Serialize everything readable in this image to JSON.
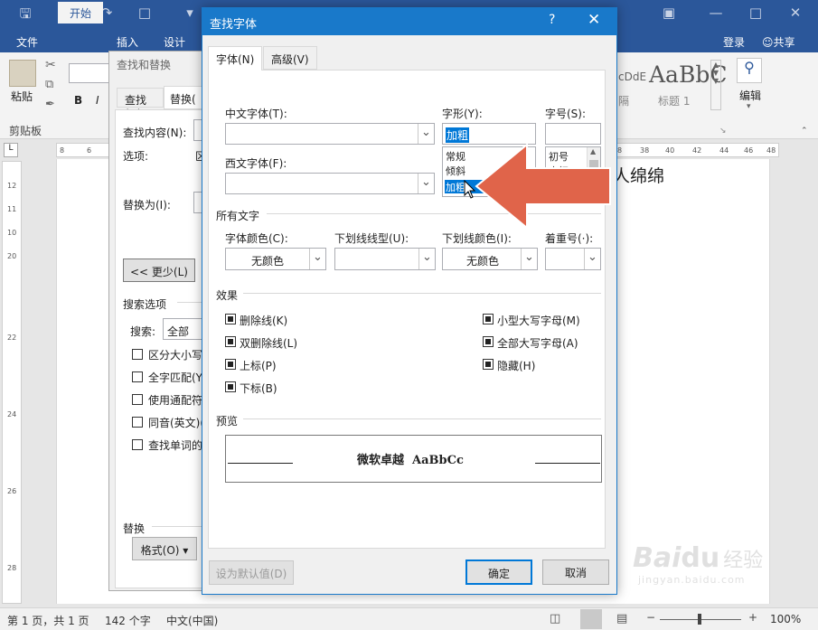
{
  "word": {
    "ribbon_tabs": [
      "文件",
      "开始",
      "插入",
      "设计"
    ],
    "login": "登录",
    "share": "共享",
    "paste_label": "粘贴",
    "clipboard_label": "剪贴板",
    "style_preview": "AaBbC",
    "style_preview2": "cDdE",
    "style_name": "标题 1",
    "style_name_partial": "隔",
    "edit_label": "编辑",
    "doc_text_fragment": "人绵绵",
    "ruler_top": [
      "8",
      "6",
      "4",
      "2",
      "2",
      "4",
      "6",
      "8",
      "38",
      "40",
      "42",
      "44",
      "46",
      "48"
    ],
    "ruler_left": [
      "12",
      "11",
      "10",
      "9",
      "8",
      "7",
      "6",
      "5",
      "4",
      "3",
      "2",
      "1",
      "20",
      "22",
      "24",
      "26",
      "28",
      "30",
      "32",
      "34"
    ],
    "status": {
      "page": "第 1 页，共 1 页",
      "words": "142 个字",
      "language": "中文(中国)",
      "zoom": "100%"
    }
  },
  "find_replace": {
    "title": "查找和替换",
    "tab_find": "查找(D)",
    "tab_replace": "替换(",
    "find_what_label": "查找内容(N):",
    "options_label": "选项:",
    "options_value": "区",
    "replace_with_label": "替换为(I):",
    "less_button": "<< 更少(L)",
    "search_options_label": "搜索选项",
    "search_label": "搜索:",
    "search_value": "全部",
    "checkboxes": [
      "区分大小写",
      "全字匹配(Y)",
      "使用通配符",
      "同音(英文)(",
      "查找单词的所"
    ],
    "replace_section": "替换",
    "format_button": "格式(O)"
  },
  "find_font": {
    "title": "查找字体",
    "help": "?",
    "close": "✕",
    "tab_font": "字体(N)",
    "tab_advanced": "高级(V)",
    "chinese_font_label": "中文字体(T):",
    "western_font_label": "西文字体(F):",
    "style_label": "字形(Y):",
    "size_label": "字号(S):",
    "style_value": "加粗",
    "style_options": [
      "常规",
      "倾斜",
      "加粗"
    ],
    "size_options": [
      "初号",
      "小初"
    ],
    "all_text_label": "所有文字",
    "font_color_label": "字体颜色(C):",
    "font_color_value": "无颜色",
    "underline_style_label": "下划线线型(U):",
    "underline_color_label": "下划线颜色(I):",
    "underline_color_value": "无颜色",
    "emphasis_label": "着重号(·):",
    "effects_label": "效果",
    "effects_left": [
      "删除线(K)",
      "双删除线(L)",
      "上标(P)",
      "下标(B)"
    ],
    "effects_right": [
      "小型大写字母(M)",
      "全部大写字母(A)",
      "隐藏(H)"
    ],
    "preview_label": "预览",
    "preview_text": "微软卓越  AaBbCc",
    "set_default_button": "设为默认值(D)",
    "ok_button": "确定",
    "cancel_button": "取消"
  },
  "watermark": {
    "brand": "Bai",
    "brand2": "du",
    "brand_cn": "经验",
    "url": "jingyan.baidu.com"
  },
  "colors": {
    "word_blue": "#2b579a",
    "dialog_blue": "#1979ca",
    "selection": "#0078d7",
    "arrow": "#e0644a"
  }
}
